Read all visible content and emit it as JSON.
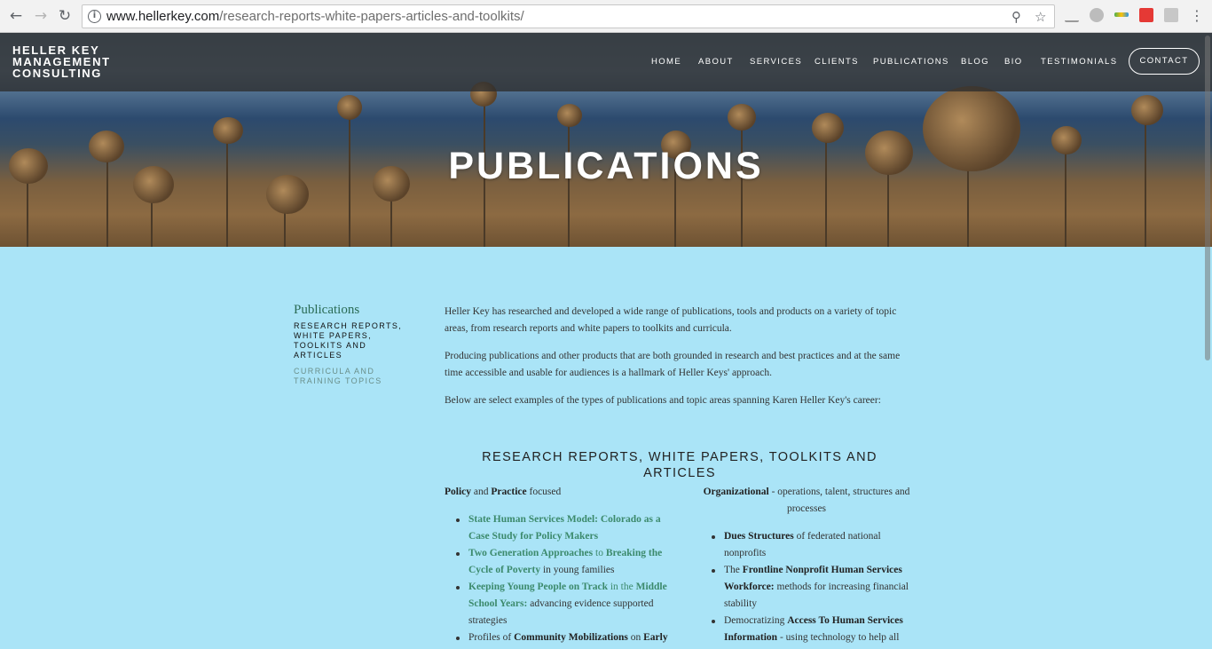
{
  "browser": {
    "url_host": "www.hellerkey.com",
    "url_path": "/research-reports-white-papers-articles-and-toolkits/"
  },
  "site": {
    "logo": [
      "HELLER KEY",
      "MANAGEMENT",
      "CONSULTING"
    ],
    "nav": [
      "HOME",
      "ABOUT",
      "SERVICES",
      "CLIENTS",
      "PUBLICATIONS",
      "BLOG",
      "BIO",
      "TESTIMONIALS"
    ],
    "contact": "CONTACT",
    "hero_title": "PUBLICATIONS"
  },
  "sidebar": {
    "title": "Publications",
    "links": [
      "RESEARCH REPORTS, WHITE PAPERS, TOOLKITS AND ARTICLES",
      "CURRICULA AND TRAINING TOPICS"
    ]
  },
  "intro": [
    "Heller Key has researched and developed a wide range of publications, tools and products on a variety of topic areas, from research reports and white papers to toolkits and curricula.",
    "Producing publications and other products that are both grounded in research and best practices and at the same time accessible and usable for audiences is a hallmark of Heller Keys' approach.",
    "Below are select examples of the types of publications and topic areas spanning Karen Heller Key's career:"
  ],
  "section_title": "RESEARCH REPORTS, WHITE PAPERS, TOOLKITS AND ARTICLES",
  "left_col": {
    "heading_1": "Policy",
    "heading_mid": " and ",
    "heading_2": "Practice",
    "heading_end": " focused",
    "items": [
      {
        "a": "State Human Services Model: Colorado as a Case Study for Policy Makers"
      },
      {
        "a": "Two Generation Approaches",
        "b": " to ",
        "c": "Breaking the Cycle of Poverty",
        "d": " in young families"
      },
      {
        "a": "Keeping Young People on Track",
        "b": " in the ",
        "c": "Middle School Years:",
        "d": " advancing evidence supported strategies"
      },
      {
        "a": "Profiles of ",
        "b": "Community Mobilizations",
        "c": " on ",
        "d": "Early"
      }
    ]
  },
  "right_col": {
    "heading": "Organizational",
    "heading_rest": " - operations, talent, structures and processes",
    "items": [
      {
        "a": "Dues Structures",
        "b": " of federated national nonprofits"
      },
      {
        "a": "The ",
        "b": "Frontline Nonprofit Human Services Workforce:",
        "c": " methods for increasing financial stability"
      },
      {
        "a": "Democratizing ",
        "b": "Access To Human Services Information",
        "c": " - using technology to help all Americans access services"
      }
    ]
  }
}
